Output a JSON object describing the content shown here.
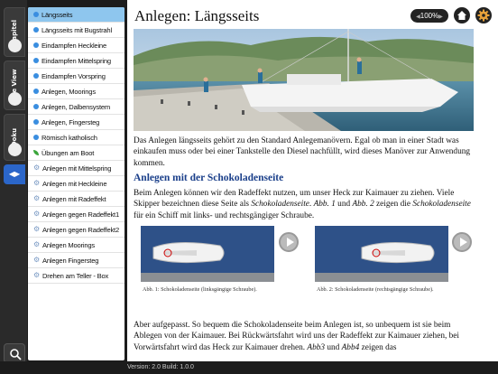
{
  "rail": {
    "tabs": [
      {
        "label": "Kapitel"
      },
      {
        "label": "Site View"
      },
      {
        "label": "Doku"
      }
    ]
  },
  "chapters": [
    {
      "label": "Längsseits",
      "kind": "dot",
      "selected": true
    },
    {
      "label": "Längsseits mit Bugstrahl",
      "kind": "dot"
    },
    {
      "label": "Eindampfen Heckleine",
      "kind": "dot"
    },
    {
      "label": "Eindampfen Mittelspring",
      "kind": "dot"
    },
    {
      "label": "Eindampfen Vorspring",
      "kind": "dot"
    },
    {
      "label": "Anlegen, Moorings",
      "kind": "dot"
    },
    {
      "label": "Anlegen, Dalbensystem",
      "kind": "dot"
    },
    {
      "label": "Anlegen, Fingersteg",
      "kind": "dot"
    },
    {
      "label": "Römisch katholisch",
      "kind": "dot"
    },
    {
      "label": "Übungen am Boot",
      "kind": "leaf"
    },
    {
      "label": "Anlegen mit Mittelspring",
      "kind": "gear"
    },
    {
      "label": "Anlegen mit Heckleine",
      "kind": "gear"
    },
    {
      "label": "Anlegen mit Radeffekt",
      "kind": "gear"
    },
    {
      "label": "Anlegen gegen Radeffekt1",
      "kind": "gear"
    },
    {
      "label": "Anlegen gegen Radeffekt2",
      "kind": "gear"
    },
    {
      "label": "Anlegen Moorings",
      "kind": "gear"
    },
    {
      "label": "Anlegen Fingersteg",
      "kind": "gear"
    },
    {
      "label": "Drehen am Teller - Box",
      "kind": "gear"
    }
  ],
  "header": {
    "title": "Anlegen: Längsseits",
    "zoom": "100%"
  },
  "content": {
    "intro": "Das Anlegen längsseits gehört zu den Standard Anlegemanövern. Egal ob man in einer Stadt was einkaufen muss oder bei einer Tankstelle den Diesel nachfüllt, wird dieses Manöver zur Anwendung kommen.",
    "heading": "Anlegen mit der Schokoladenseite",
    "para1_a": "Beim Anlegen können wir den Radeffekt nutzen, um unser Heck zur Kaimauer zu ziehen. Viele Skipper bezeichnen diese Seite als ",
    "para1_b": "Schokoladenseite",
    "para1_c": ". ",
    "para1_d": "Abb. 1",
    "para1_e": " und ",
    "para1_f": "Abb. 2",
    "para1_g": " zeigen die ",
    "para1_h": "Schokoladenseite",
    "para1_i": " für ein Schiff mit links- und rechtsgängiger Schraube.",
    "fig1_caption": "Abb. 1: Schokoladenseite (linksgängige Schraube).",
    "fig2_caption": "Abb. 2: Schokoladenseite (rechtsgängige Schraube).",
    "para2_a": "Aber aufgepasst. So bequem die Schokoladenseite beim Anlegen ist, so unbequem ist sie beim Ablegen von der Kaimauer. Bei Rückwärtsfahrt wird uns der Radeffekt zur Kaimauer ziehen, bei Vorwärtsfahrt wird das Heck zur Kaimauer drehen. ",
    "para2_b": "Abb3",
    "para2_c": " und ",
    "para2_d": "Abb4",
    "para2_e": " zeigen das"
  },
  "footer": {
    "version": "Version: 2.0  Build:  1.0.0"
  },
  "colors": {
    "accent": "#2b66c9",
    "selected_row": "#8ec6ee",
    "heading": "#1a3f8a"
  }
}
